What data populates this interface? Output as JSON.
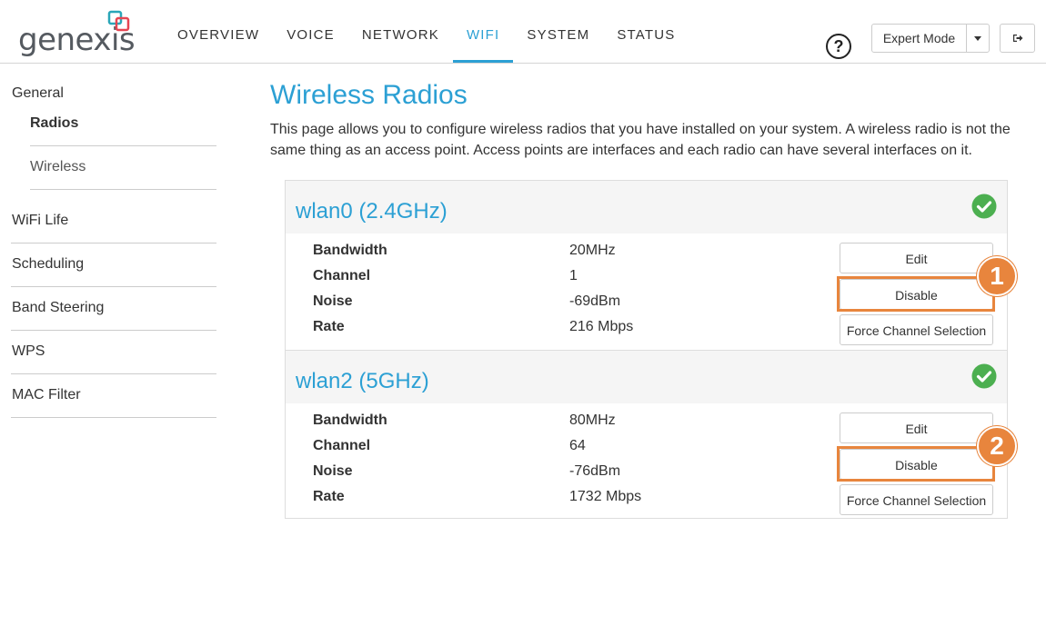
{
  "brand": {
    "logo_text": "genexis"
  },
  "nav": {
    "items": [
      {
        "label": "OVERVIEW"
      },
      {
        "label": "VOICE"
      },
      {
        "label": "NETWORK"
      },
      {
        "label": "WIFI"
      },
      {
        "label": "SYSTEM"
      },
      {
        "label": "STATUS"
      }
    ],
    "active": "WIFI"
  },
  "header": {
    "help_symbol": "?",
    "mode_label": "Expert Mode"
  },
  "sidebar": {
    "general": "General",
    "sub_items": [
      {
        "label": "Radios"
      },
      {
        "label": "Wireless"
      }
    ],
    "items": [
      {
        "label": "WiFi Life"
      },
      {
        "label": "Scheduling"
      },
      {
        "label": "Band Steering"
      },
      {
        "label": "WPS"
      },
      {
        "label": "MAC Filter"
      }
    ]
  },
  "page": {
    "title": "Wireless Radios",
    "description": "This page allows you to configure wireless radios that you have installed on your system. A wireless radio is not the same thing as an access point. Access points are interfaces and each radio can have several interfaces on it."
  },
  "radios": [
    {
      "name": "wlan0 (2.4GHz)",
      "status": "enabled",
      "props": [
        {
          "label": "Bandwidth",
          "value": "20MHz"
        },
        {
          "label": "Channel",
          "value": "1"
        },
        {
          "label": "Noise",
          "value": "-69dBm"
        },
        {
          "label": "Rate",
          "value": "216 Mbps"
        }
      ],
      "buttons": {
        "edit": "Edit",
        "disable": "Disable",
        "force": "Force Channel Selection"
      },
      "marker": "1"
    },
    {
      "name": "wlan2 (5GHz)",
      "status": "enabled",
      "props": [
        {
          "label": "Bandwidth",
          "value": "80MHz"
        },
        {
          "label": "Channel",
          "value": "64"
        },
        {
          "label": "Noise",
          "value": "-76dBm"
        },
        {
          "label": "Rate",
          "value": "1732 Mbps"
        }
      ],
      "buttons": {
        "edit": "Edit",
        "disable": "Disable",
        "force": "Force Channel Selection"
      },
      "marker": "2"
    }
  ],
  "colors": {
    "accent": "#2ca0d4",
    "highlight": "#e8853d",
    "status_ok": "#4caf50",
    "logo_red": "#e64552",
    "logo_teal": "#2aa6b8"
  }
}
